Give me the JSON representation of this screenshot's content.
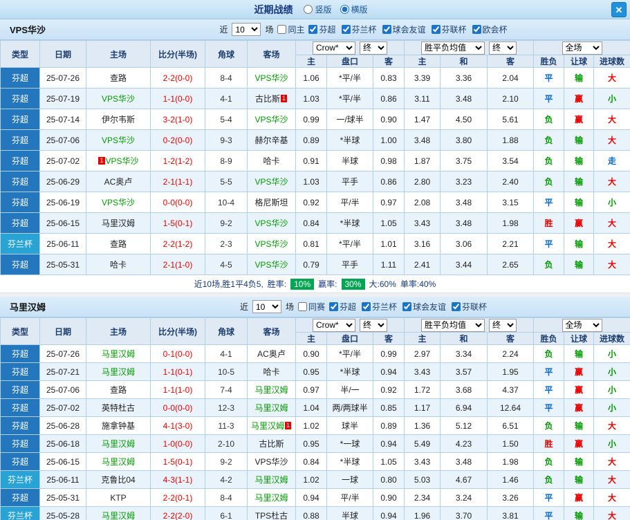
{
  "topbar": {
    "title": "近期战绩",
    "layout_vertical": "竖版",
    "layout_horizontal": "横版",
    "close_glyph": "✕"
  },
  "colors": {
    "type_blue": "#2577bd",
    "type_cyan": "#28a3d4",
    "red": "#e60000",
    "green": "#009900",
    "blue": "#0066cc",
    "team_green": "#009900",
    "badge_green": "#00a651"
  },
  "table_header": {
    "cols": {
      "type": "类型",
      "date": "日期",
      "home": "主场",
      "score": "比分(半场)",
      "corners": "角球",
      "away": "客场",
      "odds_home": "主",
      "odds_hcap": "盘口",
      "odds_away": "客",
      "avg_home": "主",
      "avg_draw": "和",
      "avg_away": "客",
      "res_wdl": "胜负",
      "res_hcap": "让球",
      "res_goals": "进球数"
    },
    "selects": {
      "bookmaker": "Crow*",
      "final": "终",
      "avg": "胜平负均值",
      "scope": "全场"
    }
  },
  "sections": [
    {
      "team": "VPS华沙",
      "filters": {
        "recent_label": "近",
        "count": "10",
        "games_label": "场",
        "scope_label": "同主",
        "scope_checked": false,
        "leagues": [
          {
            "label": "芬超",
            "checked": true
          },
          {
            "label": "芬兰杯",
            "checked": true
          },
          {
            "label": "球会友谊",
            "checked": true
          },
          {
            "label": "芬联杯",
            "checked": true
          },
          {
            "label": "欧会杯",
            "checked": true
          }
        ]
      },
      "rows": [
        {
          "type": "芬超",
          "cup": false,
          "date": "25-07-26",
          "home": {
            "name": "查路"
          },
          "score": "2-2(0-0)",
          "corners": "8-4",
          "away": {
            "name": "VPS华沙",
            "hl": true
          },
          "odds": [
            "1.06",
            "*平/半",
            "0.83"
          ],
          "avg": [
            "3.39",
            "3.36",
            "2.04"
          ],
          "results": [
            {
              "t": "平",
              "c": "b"
            },
            {
              "t": "输",
              "c": "g"
            },
            {
              "t": "大",
              "c": "r"
            }
          ]
        },
        {
          "type": "芬超",
          "cup": false,
          "date": "25-07-19",
          "home": {
            "name": "VPS华沙",
            "hl": true
          },
          "score": "1-1(0-0)",
          "corners": "4-1",
          "away": {
            "name": "古比斯",
            "rc": "1",
            "rc_pos": "after"
          },
          "odds": [
            "1.03",
            "*平/半",
            "0.86"
          ],
          "avg": [
            "3.11",
            "3.48",
            "2.10"
          ],
          "results": [
            {
              "t": "平",
              "c": "b"
            },
            {
              "t": "赢",
              "c": "r"
            },
            {
              "t": "小",
              "c": "g"
            }
          ]
        },
        {
          "type": "芬超",
          "cup": false,
          "date": "25-07-14",
          "home": {
            "name": "伊尔韦斯"
          },
          "score": "3-2(1-0)",
          "corners": "5-4",
          "away": {
            "name": "VPS华沙",
            "hl": true
          },
          "odds": [
            "0.99",
            "一/球半",
            "0.90"
          ],
          "avg": [
            "1.47",
            "4.50",
            "5.61"
          ],
          "results": [
            {
              "t": "负",
              "c": "g"
            },
            {
              "t": "赢",
              "c": "r"
            },
            {
              "t": "大",
              "c": "r"
            }
          ]
        },
        {
          "type": "芬超",
          "cup": false,
          "date": "25-07-06",
          "home": {
            "name": "VPS华沙",
            "hl": true
          },
          "score": "0-2(0-0)",
          "corners": "9-3",
          "away": {
            "name": "赫尔辛基"
          },
          "odds": [
            "0.89",
            "*半球",
            "1.00"
          ],
          "avg": [
            "3.48",
            "3.80",
            "1.88"
          ],
          "results": [
            {
              "t": "负",
              "c": "g"
            },
            {
              "t": "输",
              "c": "g"
            },
            {
              "t": "大",
              "c": "r"
            }
          ]
        },
        {
          "type": "芬超",
          "cup": false,
          "date": "25-07-02",
          "home": {
            "name": "VPS华沙",
            "hl": true,
            "rc": "1",
            "rc_pos": "before"
          },
          "score": "1-2(1-2)",
          "corners": "8-9",
          "away": {
            "name": "哈卡"
          },
          "odds": [
            "0.91",
            "半球",
            "0.98"
          ],
          "avg": [
            "1.87",
            "3.75",
            "3.54"
          ],
          "results": [
            {
              "t": "负",
              "c": "g"
            },
            {
              "t": "输",
              "c": "g"
            },
            {
              "t": "走",
              "c": "b"
            }
          ]
        },
        {
          "type": "芬超",
          "cup": false,
          "date": "25-06-29",
          "home": {
            "name": "AC奥卢"
          },
          "score": "2-1(1-1)",
          "corners": "5-5",
          "away": {
            "name": "VPS华沙",
            "hl": true
          },
          "odds": [
            "1.03",
            "平手",
            "0.86"
          ],
          "avg": [
            "2.80",
            "3.23",
            "2.40"
          ],
          "results": [
            {
              "t": "负",
              "c": "g"
            },
            {
              "t": "输",
              "c": "g"
            },
            {
              "t": "大",
              "c": "r"
            }
          ]
        },
        {
          "type": "芬超",
          "cup": false,
          "date": "25-06-19",
          "home": {
            "name": "VPS华沙",
            "hl": true
          },
          "score": "0-0(0-0)",
          "corners": "10-4",
          "away": {
            "name": "格尼斯坦"
          },
          "odds": [
            "0.92",
            "平/半",
            "0.97"
          ],
          "avg": [
            "2.08",
            "3.48",
            "3.15"
          ],
          "results": [
            {
              "t": "平",
              "c": "b"
            },
            {
              "t": "输",
              "c": "g"
            },
            {
              "t": "小",
              "c": "g"
            }
          ]
        },
        {
          "type": "芬超",
          "cup": false,
          "date": "25-06-15",
          "home": {
            "name": "马里汉姆"
          },
          "score": "1-5(0-1)",
          "corners": "9-2",
          "away": {
            "name": "VPS华沙",
            "hl": true
          },
          "odds": [
            "0.84",
            "*半球",
            "1.05"
          ],
          "avg": [
            "3.43",
            "3.48",
            "1.98"
          ],
          "results": [
            {
              "t": "胜",
              "c": "r"
            },
            {
              "t": "赢",
              "c": "r"
            },
            {
              "t": "大",
              "c": "r"
            }
          ]
        },
        {
          "type": "芬兰杯",
          "cup": true,
          "date": "25-06-11",
          "home": {
            "name": "查路"
          },
          "score": "2-2(1-2)",
          "corners": "2-3",
          "away": {
            "name": "VPS华沙",
            "hl": true
          },
          "odds": [
            "0.81",
            "*平/半",
            "1.01"
          ],
          "avg": [
            "3.16",
            "3.06",
            "2.21"
          ],
          "results": [
            {
              "t": "平",
              "c": "b"
            },
            {
              "t": "输",
              "c": "g"
            },
            {
              "t": "大",
              "c": "r"
            }
          ]
        },
        {
          "type": "芬超",
          "cup": false,
          "date": "25-05-31",
          "home": {
            "name": "哈卡"
          },
          "score": "2-1(1-0)",
          "corners": "4-5",
          "away": {
            "name": "VPS华沙",
            "hl": true
          },
          "odds": [
            "0.79",
            "平手",
            "1.11"
          ],
          "avg": [
            "2.41",
            "3.44",
            "2.65"
          ],
          "results": [
            {
              "t": "负",
              "c": "g"
            },
            {
              "t": "输",
              "c": "g"
            },
            {
              "t": "大",
              "c": "r"
            }
          ]
        }
      ],
      "summary": {
        "text": "近10场,胜1平4负5,",
        "win_rate_label": "胜率:",
        "win_rate": "10%",
        "handicap_rate_label": "赢率:",
        "handicap_rate": "30%",
        "big_rate": "大:60%",
        "single_rate": "单率:40%"
      }
    },
    {
      "team": "马里汉姆",
      "filters": {
        "recent_label": "近",
        "count": "10",
        "games_label": "场",
        "scope_label": "同赛",
        "scope_checked": false,
        "leagues": [
          {
            "label": "芬超",
            "checked": true
          },
          {
            "label": "芬兰杯",
            "checked": true
          },
          {
            "label": "球会友谊",
            "checked": true
          },
          {
            "label": "芬联杯",
            "checked": true
          }
        ]
      },
      "rows": [
        {
          "type": "芬超",
          "cup": false,
          "date": "25-07-26",
          "home": {
            "name": "马里汉姆",
            "hl": true
          },
          "score": "0-1(0-0)",
          "corners": "4-1",
          "away": {
            "name": "AC奥卢"
          },
          "odds": [
            "0.90",
            "*平/半",
            "0.99"
          ],
          "avg": [
            "2.97",
            "3.34",
            "2.24"
          ],
          "results": [
            {
              "t": "负",
              "c": "g"
            },
            {
              "t": "输",
              "c": "g"
            },
            {
              "t": "小",
              "c": "g"
            }
          ]
        },
        {
          "type": "芬超",
          "cup": false,
          "date": "25-07-21",
          "home": {
            "name": "马里汉姆",
            "hl": true
          },
          "score": "1-1(0-1)",
          "corners": "10-5",
          "away": {
            "name": "哈卡"
          },
          "odds": [
            "0.95",
            "*半球",
            "0.94"
          ],
          "avg": [
            "3.43",
            "3.57",
            "1.95"
          ],
          "results": [
            {
              "t": "平",
              "c": "b"
            },
            {
              "t": "赢",
              "c": "r"
            },
            {
              "t": "小",
              "c": "g"
            }
          ]
        },
        {
          "type": "芬超",
          "cup": false,
          "date": "25-07-06",
          "home": {
            "name": "查路"
          },
          "score": "1-1(1-0)",
          "corners": "7-4",
          "away": {
            "name": "马里汉姆",
            "hl": true
          },
          "odds": [
            "0.97",
            "半/一",
            "0.92"
          ],
          "avg": [
            "1.72",
            "3.68",
            "4.37"
          ],
          "results": [
            {
              "t": "平",
              "c": "b"
            },
            {
              "t": "赢",
              "c": "r"
            },
            {
              "t": "小",
              "c": "g"
            }
          ]
        },
        {
          "type": "芬超",
          "cup": false,
          "date": "25-07-02",
          "home": {
            "name": "英特杜古"
          },
          "score": "0-0(0-0)",
          "corners": "12-3",
          "away": {
            "name": "马里汉姆",
            "hl": true
          },
          "odds": [
            "1.04",
            "两/两球半",
            "0.85"
          ],
          "avg": [
            "1.17",
            "6.94",
            "12.64"
          ],
          "results": [
            {
              "t": "平",
              "c": "b"
            },
            {
              "t": "赢",
              "c": "r"
            },
            {
              "t": "小",
              "c": "g"
            }
          ]
        },
        {
          "type": "芬超",
          "cup": false,
          "date": "25-06-28",
          "home": {
            "name": "施拿钟基"
          },
          "score": "4-1(3-0)",
          "corners": "11-3",
          "away": {
            "name": "马里汉姆",
            "hl": true,
            "rc": "1",
            "rc_pos": "after"
          },
          "odds": [
            "1.02",
            "球半",
            "0.89"
          ],
          "avg": [
            "1.36",
            "5.12",
            "6.51"
          ],
          "results": [
            {
              "t": "负",
              "c": "g"
            },
            {
              "t": "输",
              "c": "g"
            },
            {
              "t": "大",
              "c": "r"
            }
          ]
        },
        {
          "type": "芬超",
          "cup": false,
          "date": "25-06-18",
          "home": {
            "name": "马里汉姆",
            "hl": true
          },
          "score": "1-0(0-0)",
          "corners": "2-10",
          "away": {
            "name": "古比斯"
          },
          "odds": [
            "0.95",
            "*一球",
            "0.94"
          ],
          "avg": [
            "5.49",
            "4.23",
            "1.50"
          ],
          "results": [
            {
              "t": "胜",
              "c": "r"
            },
            {
              "t": "赢",
              "c": "r"
            },
            {
              "t": "小",
              "c": "g"
            }
          ]
        },
        {
          "type": "芬超",
          "cup": false,
          "date": "25-06-15",
          "home": {
            "name": "马里汉姆",
            "hl": true
          },
          "score": "1-5(0-1)",
          "corners": "9-2",
          "away": {
            "name": "VPS华沙"
          },
          "odds": [
            "0.84",
            "*半球",
            "1.05"
          ],
          "avg": [
            "3.43",
            "3.48",
            "1.98"
          ],
          "results": [
            {
              "t": "负",
              "c": "g"
            },
            {
              "t": "输",
              "c": "g"
            },
            {
              "t": "大",
              "c": "r"
            }
          ]
        },
        {
          "type": "芬兰杯",
          "cup": true,
          "date": "25-06-11",
          "home": {
            "name": "克鲁比04"
          },
          "score": "4-3(1-1)",
          "corners": "4-2",
          "away": {
            "name": "马里汉姆",
            "hl": true
          },
          "odds": [
            "1.02",
            "一球",
            "0.80"
          ],
          "avg": [
            "5.03",
            "4.67",
            "1.46"
          ],
          "results": [
            {
              "t": "负",
              "c": "g"
            },
            {
              "t": "输",
              "c": "g"
            },
            {
              "t": "大",
              "c": "r"
            }
          ]
        },
        {
          "type": "芬超",
          "cup": false,
          "date": "25-05-31",
          "home": {
            "name": "KTP"
          },
          "score": "2-2(0-1)",
          "corners": "8-4",
          "away": {
            "name": "马里汉姆",
            "hl": true
          },
          "odds": [
            "0.94",
            "平/半",
            "0.90"
          ],
          "avg": [
            "2.34",
            "3.24",
            "3.26"
          ],
          "results": [
            {
              "t": "平",
              "c": "b"
            },
            {
              "t": "赢",
              "c": "r"
            },
            {
              "t": "大",
              "c": "r"
            }
          ]
        },
        {
          "type": "芬兰杯",
          "cup": true,
          "date": "25-05-28",
          "home": {
            "name": "马里汉姆",
            "hl": true
          },
          "score": "2-2(2-0)",
          "corners": "6-1",
          "away": {
            "name": "TPS杜古"
          },
          "odds": [
            "0.88",
            "半球",
            "0.94"
          ],
          "avg": [
            "1.96",
            "3.70",
            "3.81"
          ],
          "results": [
            {
              "t": "平",
              "c": "b"
            },
            {
              "t": "输",
              "c": "g"
            },
            {
              "t": "大",
              "c": "r"
            }
          ]
        }
      ]
    }
  ]
}
